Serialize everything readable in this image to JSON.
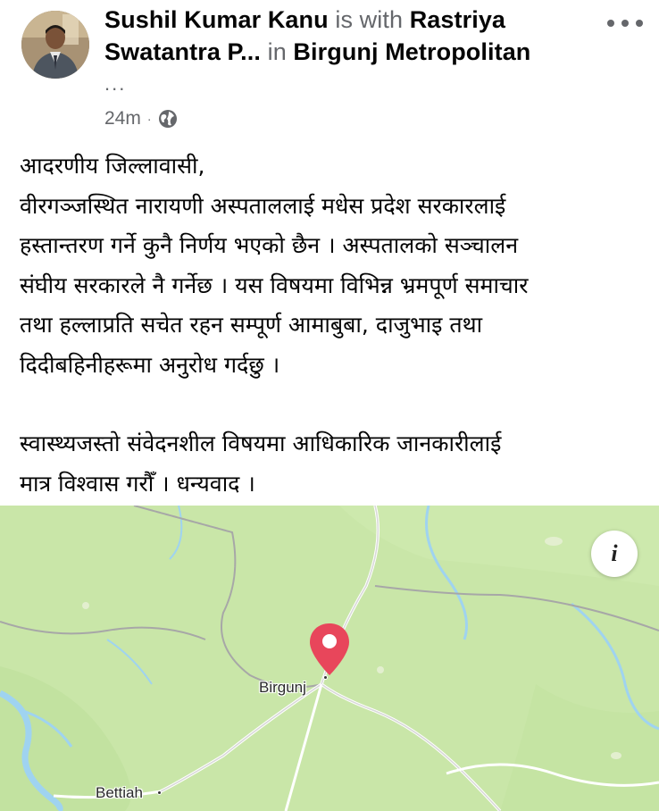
{
  "post": {
    "author": "Sushil Kumar Kanu",
    "with_text": "is with",
    "tagged_entity": "Rastriya Swatantra P...",
    "in_text": "in",
    "location": "Birgunj Metropolitan",
    "location_ellipsis": "...",
    "time": "24m",
    "separator": "·",
    "privacy_icon": "globe-icon",
    "more_icon": "more-horizontal-icon",
    "body_lines": [
      "आदरणीय जिल्लावासी,",
      "वीरगञ्जस्थित नारायणी अस्पताललाई मधेस प्रदेश सरकारलाई",
      "हस्तान्तरण गर्ने कुनै निर्णय भएको छैन । अस्पतालको सञ्चालन",
      "संघीय सरकारले नै गर्नेछ । यस विषयमा विभिन्न भ्रमपूर्ण समाचार",
      "तथा हल्लाप्रति सचेत रहन सम्पूर्ण आमाबुबा, दाजुभाइ तथा",
      "दिदीबहिनीहरूमा अनुरोध गर्दछु ।"
    ],
    "body_lines_2": [
      "स्वास्थ्यजस्तो संवेदनशील विषयमा आधिकारिक जानकारीलाई",
      "मात्र विश्वास गरौँ । धन्यवाद ।"
    ]
  },
  "map": {
    "info_label": "i",
    "pin_icon": "location-pin-icon",
    "cities": [
      "Birgunj",
      "Bettiah"
    ],
    "colors": {
      "land": "#c9e6a8",
      "river": "#9fd3f0",
      "pin": "#e8465b"
    }
  }
}
